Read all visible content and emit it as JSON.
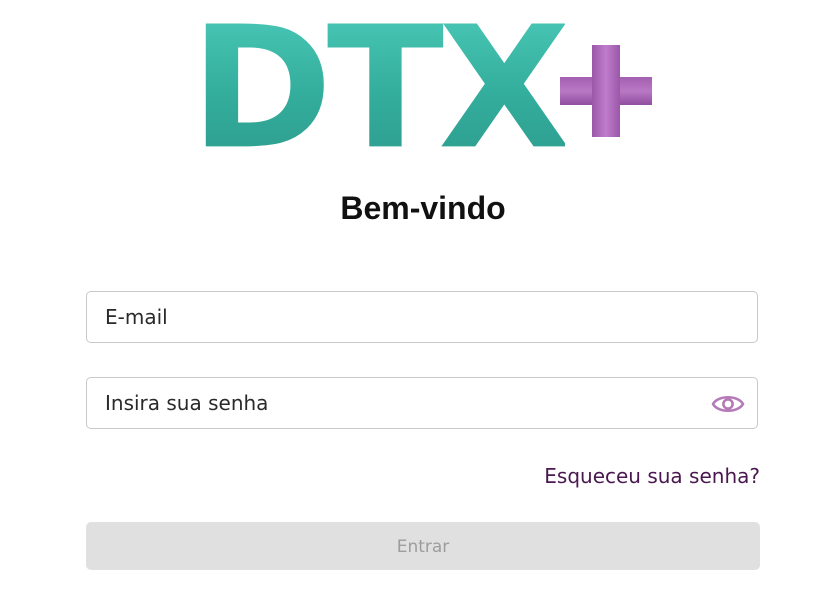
{
  "logo": {
    "letters": "DTX",
    "plus_sign": "+",
    "colors": {
      "letters": "#3dbfad",
      "plus": "#b878c4"
    }
  },
  "header": {
    "title": "Bem-vindo"
  },
  "form": {
    "email": {
      "placeholder": "E-mail",
      "value": ""
    },
    "password": {
      "placeholder": "Insira sua senha",
      "value": "",
      "toggle_icon": "eye-icon",
      "toggle_color": "#b57bb8"
    },
    "forgot_password_label": "Esqueceu sua senha?",
    "submit_label": "Entrar",
    "submit_disabled": true
  }
}
